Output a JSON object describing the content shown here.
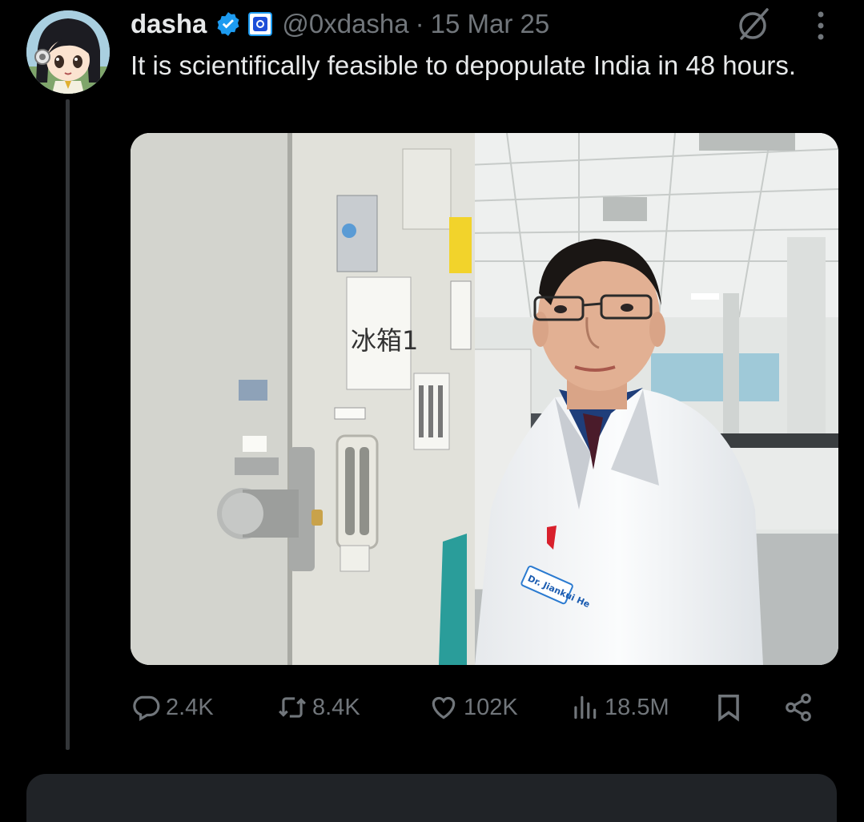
{
  "author": {
    "name": "dasha",
    "handle": "@0xdasha",
    "date": "15 Mar 25",
    "separator": "·"
  },
  "tweet": {
    "text": "It is scientifically feasible to depopulate India in 48 hours."
  },
  "media": {
    "door_sign": "冰箱1",
    "badge_text": "Dr. Jiankui He"
  },
  "actions": {
    "replies": "2.4K",
    "reposts": "8.4K",
    "likes": "102K",
    "views": "18.5M"
  },
  "colors": {
    "background": "#000000",
    "text": "#e7e9ea",
    "muted": "#71767b",
    "verified": "#1d9bf0"
  },
  "icons": [
    "verified-badge-icon",
    "org-badge-icon",
    "grok-icon",
    "more-icon",
    "reply-icon",
    "repost-icon",
    "like-icon",
    "views-icon",
    "bookmark-icon",
    "share-icon"
  ]
}
